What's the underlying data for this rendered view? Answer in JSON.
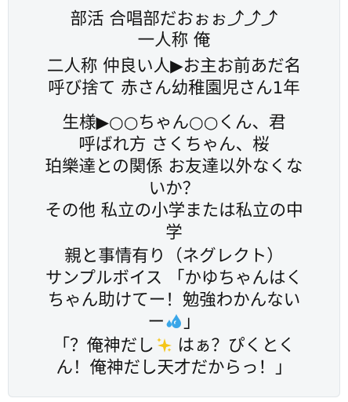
{
  "post": {
    "lines": {
      "l0": "部活 合唱部だおぉぉ⤴︎⤴︎⤴︎",
      "l1": "一人称 俺",
      "l2": "二人称 仲良い人▶お主お前あだ名",
      "l3": "呼び捨て 赤さん幼稚園児さん1年",
      "l4": "生様▶○○ちゃん○○くん、君",
      "l5": "呼ばれ方 さくちゃん、桜",
      "l6": "珀樂達との関係 お友達以外なくな",
      "l7": "いか？",
      "l8": "その他 私立の小学または私立の中",
      "l9": "学",
      "l10": "親と事情有り（ネグレクト）",
      "l11": "サンプルボイス 「かゆちゃんはく",
      "l12": "ちゃん助けてー！勉強わかんない",
      "l13a": "ー",
      "l13b": "」",
      "l14a": "「？俺神だし",
      "l14b": " はぁ？ぴくとく",
      "l15": "ん！俺神だし天才だからっ！」"
    },
    "icons": {
      "drops": "sweat-droplets-icon",
      "sparkle": "sparkles-icon"
    },
    "colors": {
      "card_bg": "#f4f6f7",
      "text": "#141414",
      "drops": "#3aa6e8",
      "sparkle": "#f5c518"
    }
  }
}
